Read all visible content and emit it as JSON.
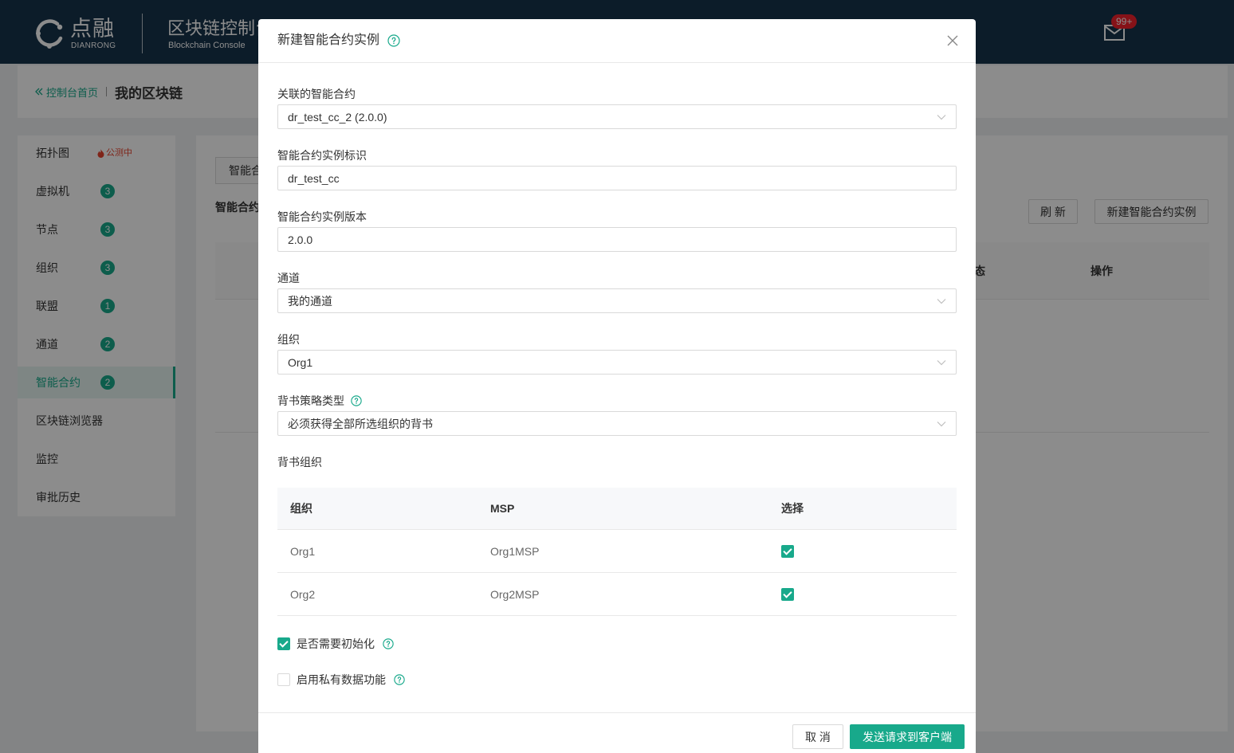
{
  "header": {
    "brand_cn": "点融",
    "brand_en": "DIANRONG",
    "console_cn": "区块链控制台",
    "console_en": "Blockchain Console",
    "mail_badge": "99+"
  },
  "breadcrumb": {
    "home": "控制台首页",
    "current": "我的区块链"
  },
  "sidebar": {
    "items": [
      {
        "label": "拓扑图",
        "tag": "公测中"
      },
      {
        "label": "虚拟机",
        "badge": "3"
      },
      {
        "label": "节点",
        "badge": "3"
      },
      {
        "label": "组织",
        "badge": "3"
      },
      {
        "label": "联盟",
        "badge": "1"
      },
      {
        "label": "通道",
        "badge": "2"
      },
      {
        "label": "智能合约",
        "badge": "2",
        "active": true
      },
      {
        "label": "区块链浏览器"
      },
      {
        "label": "监控"
      },
      {
        "label": "审批历史"
      }
    ]
  },
  "main": {
    "tab": "智能合",
    "section_title": "智能合约",
    "refresh_label": "刷 新",
    "create_label": "新建智能合约实例",
    "table_columns": [
      "态",
      "操作"
    ]
  },
  "modal": {
    "title": "新建智能合约实例",
    "fields": [
      {
        "label": "关联的智能合约",
        "value": "dr_test_cc_2 (2.0.0)",
        "type": "select"
      },
      {
        "label": "智能合约实例标识",
        "value": "dr_test_cc",
        "type": "input"
      },
      {
        "label": "智能合约实例版本",
        "value": "2.0.0",
        "type": "input"
      },
      {
        "label": "通道",
        "value": "我的通道",
        "type": "select"
      },
      {
        "label": "组织",
        "value": "Org1",
        "type": "select"
      },
      {
        "label": "背书策略类型",
        "value": "必须获得全部所选组织的背书",
        "type": "select",
        "help": true
      }
    ],
    "endorse": {
      "label": "背书组织",
      "columns": [
        "组织",
        "MSP",
        "选择"
      ],
      "rows": [
        {
          "org": "Org1",
          "msp": "Org1MSP",
          "selected": true
        },
        {
          "org": "Org2",
          "msp": "Org2MSP",
          "selected": true
        }
      ]
    },
    "options": [
      {
        "label": "是否需要初始化",
        "checked": true
      },
      {
        "label": "启用私有数据功能",
        "checked": false
      }
    ],
    "footer": {
      "cancel": "取 消",
      "submit": "发送请求到客户端"
    }
  },
  "colors": {
    "accent": "#18a98b",
    "header_bg": "#16334b",
    "mail_badge": "#f5222d",
    "beta_tag": "#e8432e"
  },
  "icons": {
    "logo": "dianrong-logo-icon",
    "mail": "mail-icon",
    "breadcrumb_back": "double-chevron-left-icon",
    "beta": "flame-icon",
    "help": "help-icon",
    "close": "close-icon",
    "dropdown": "chevron-down-icon",
    "checkbox": "checkbox-icon"
  }
}
